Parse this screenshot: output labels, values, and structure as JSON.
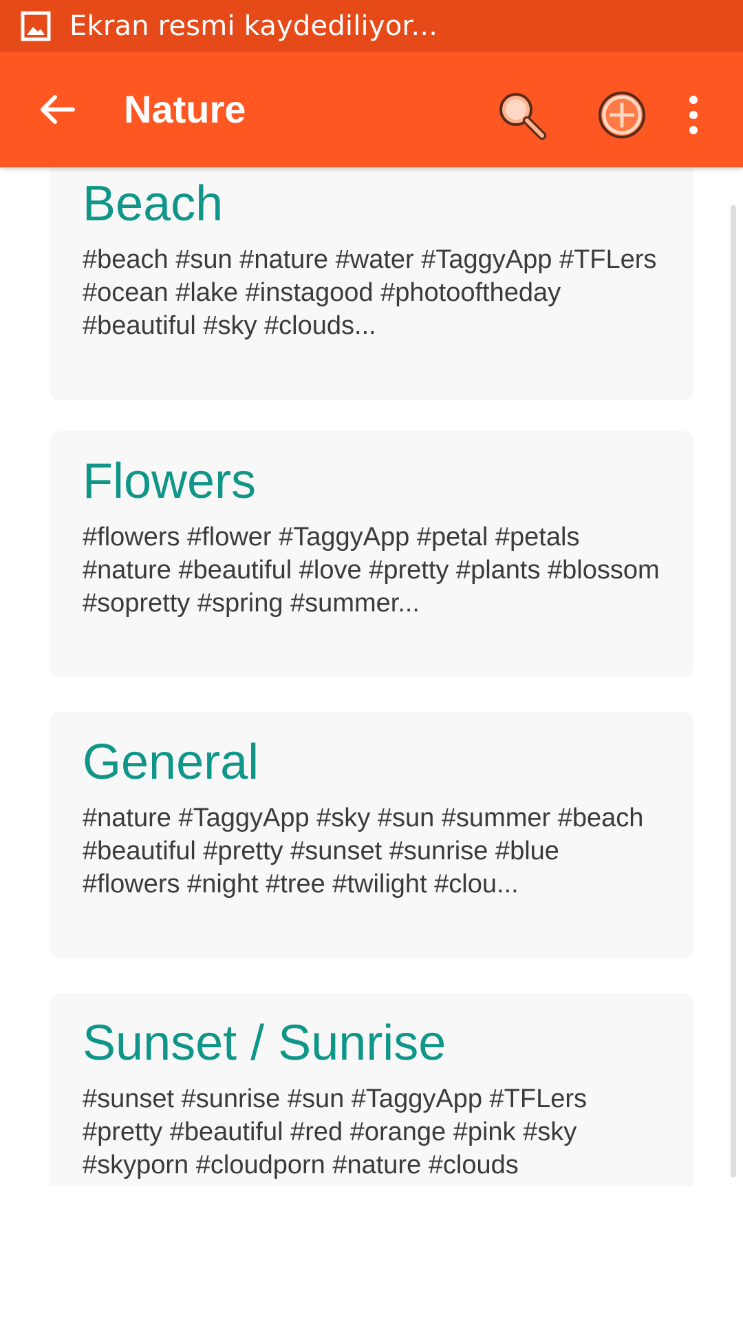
{
  "status_bar": {
    "notification_icon": "image-icon",
    "text": "Ekran resmi kaydediliyor..."
  },
  "app_bar": {
    "title": "Nature",
    "back_icon": "arrow-left-icon",
    "search_icon": "search-icon",
    "add_icon": "plus-circle-icon",
    "more_icon": "more-vertical-icon"
  },
  "cards": [
    {
      "title": "Beach",
      "tags": "#beach #sun #nature #water #TaggyApp #TFLers #ocean #lake #instagood #photooftheday #beautiful #sky #clouds..."
    },
    {
      "title": "Flowers",
      "tags": "#flowers #flower #TaggyApp #petal #petals #nature #beautiful #love #pretty #plants #blossom #sopretty #spring #summer..."
    },
    {
      "title": "General",
      "tags": "#nature #TaggyApp #sky #sun #summer #beach #beautiful #pretty #sunset #sunrise #blue #flowers #night #tree #twilight #clou..."
    },
    {
      "title": "Sunset / Sunrise",
      "tags": "#sunset #sunrise #sun #TaggyApp #TFLers #pretty #beautiful #red #orange #pink #sky #skyporn #cloudporn #nature #clouds"
    }
  ],
  "colors": {
    "status_bar": "#e64a19",
    "app_bar": "#ff5722",
    "card_title": "#0f9688",
    "card_background": "#f8f8f8"
  }
}
